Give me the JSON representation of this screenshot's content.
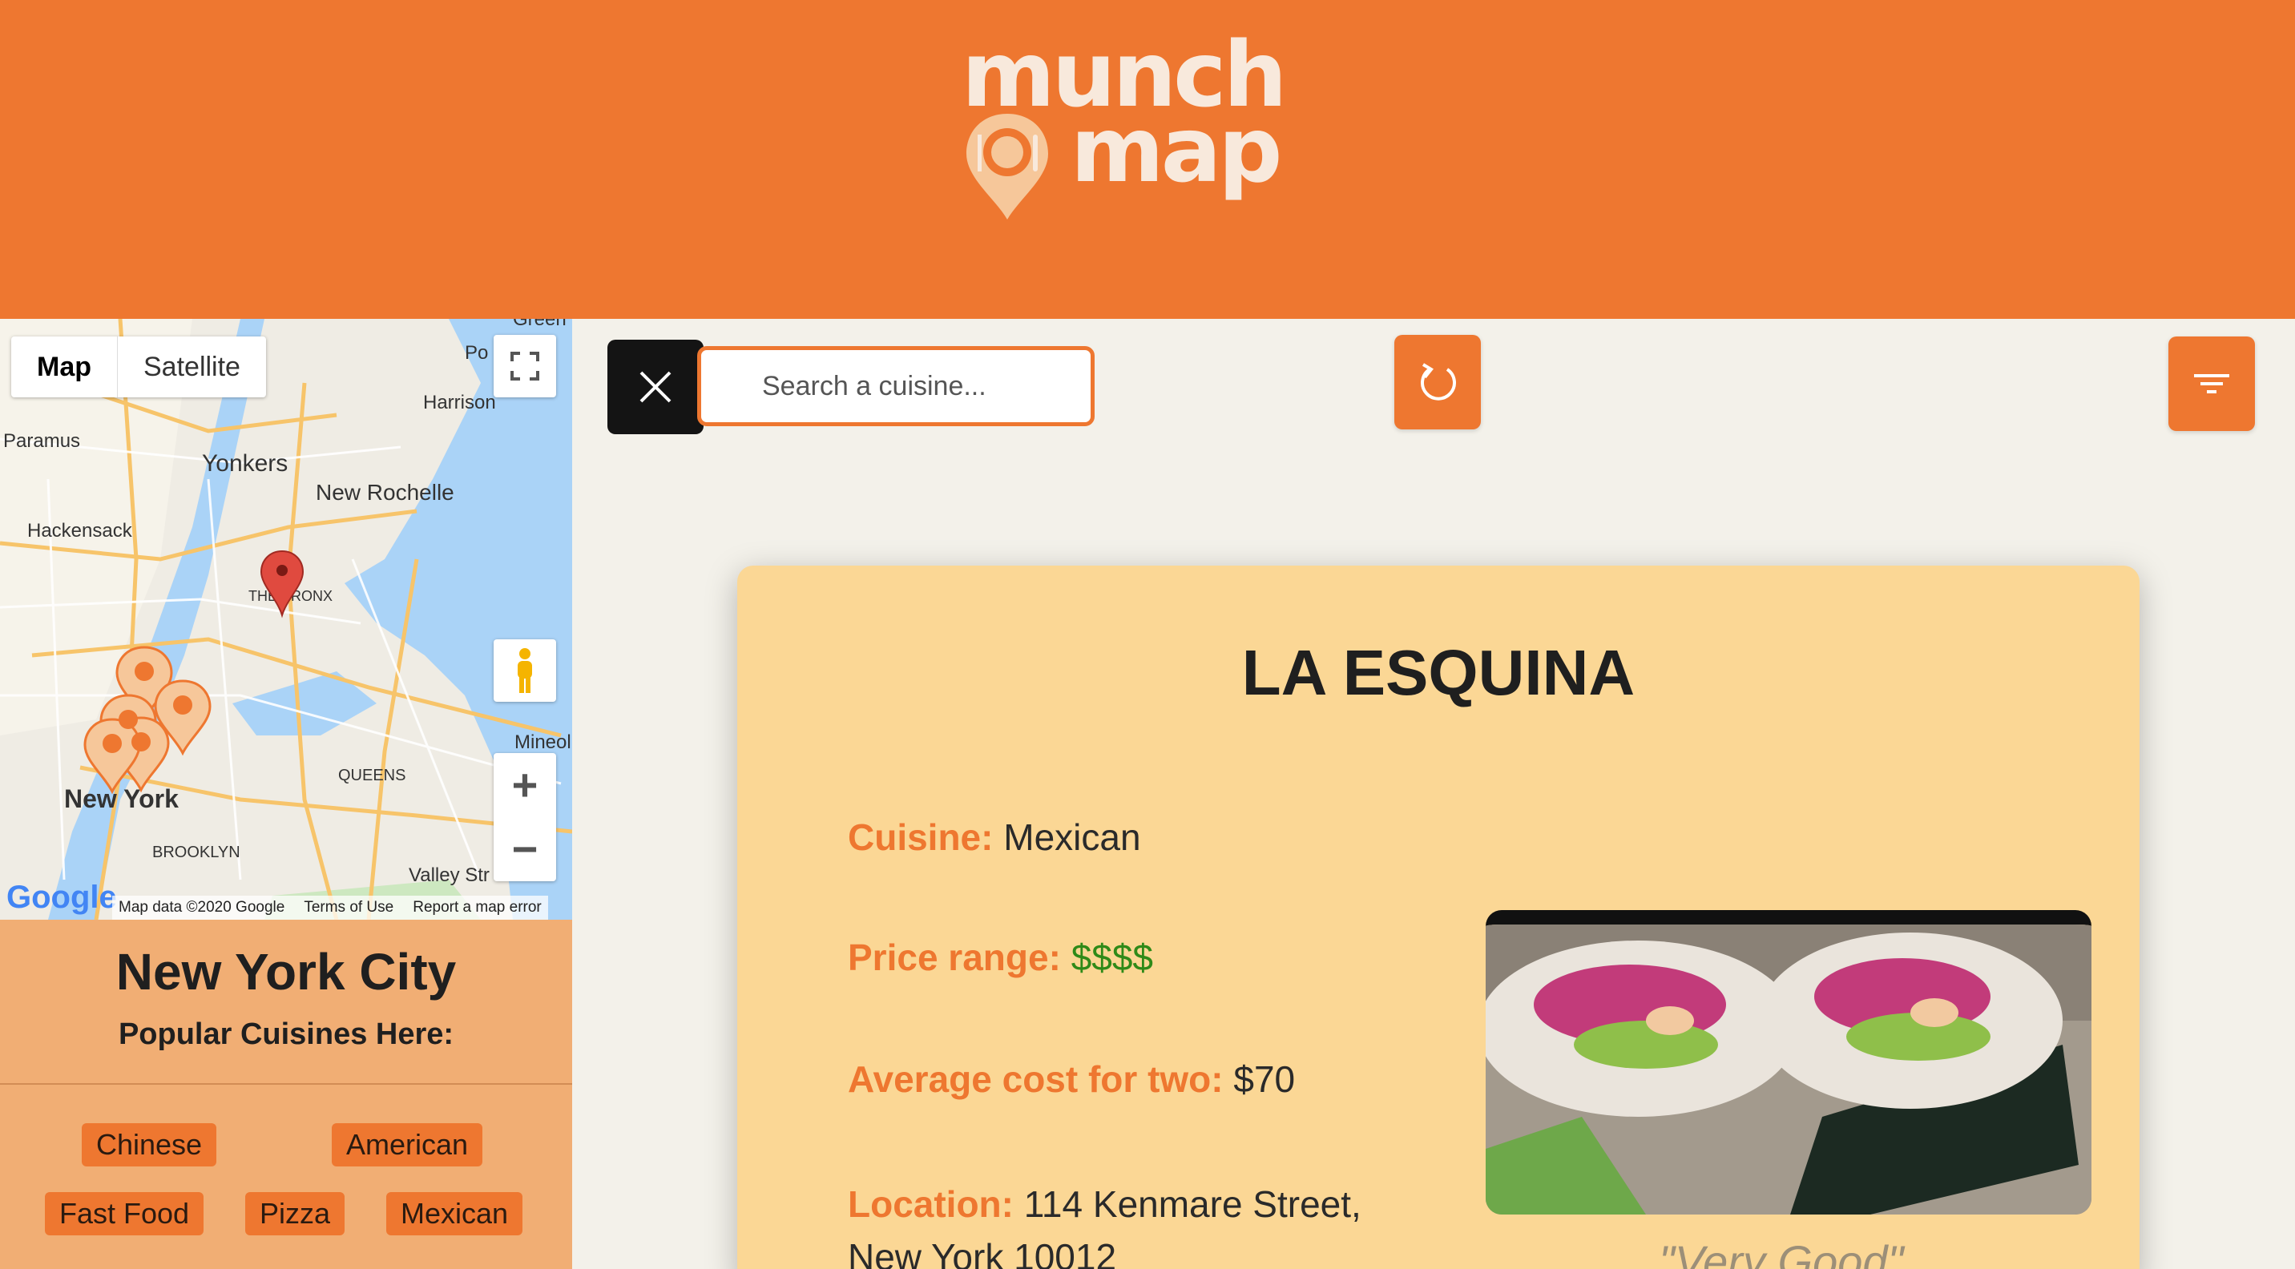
{
  "brand": {
    "word1": "munch",
    "word2": "map"
  },
  "map": {
    "type_buttons": [
      "Map",
      "Satellite"
    ],
    "labels": {
      "yonkers": "Yonkers",
      "new_rochelle": "New Rochelle",
      "paramus": "Paramus",
      "hackensack": "Hackensack",
      "harrison": "Harrison",
      "the_bronx": "THE BRONX",
      "new_york": "New York",
      "queens": "QUEENS",
      "brooklyn": "BROOKLYN",
      "mineola": "Mineol",
      "valley_stream": "Valley Str",
      "green": "Green",
      "port": "Po"
    },
    "footer": {
      "data": "Map data ©2020 Google",
      "terms": "Terms of Use",
      "report": "Report a map error"
    },
    "google": "Google",
    "zoom_in": "+",
    "zoom_out": "−"
  },
  "city": {
    "name": "New York City",
    "popular_label": "Popular Cuisines Here:",
    "cuisines": [
      "Chinese",
      "American",
      "Fast Food",
      "Pizza",
      "Mexican"
    ]
  },
  "search": {
    "placeholder": "Search a cuisine..."
  },
  "restaurant": {
    "name": "LA ESQUINA",
    "cuisine_label": "Cuisine:",
    "cuisine": "Mexican",
    "price_label": "Price range:",
    "price": "$$$$",
    "cost_label": "Average cost for two:",
    "cost": "$70",
    "location_label": "Location:",
    "location_line1": "114 Kenmare Street,",
    "location_line2": "New York 10012",
    "review": "\"Very Good\""
  },
  "colors": {
    "accent": "#ee7730",
    "card": "#fbd795",
    "sidebar": "#f1ae74",
    "price": "#2f8a18"
  },
  "icons": {
    "close": "close-icon",
    "refresh": "refresh-icon",
    "filter": "filter-icon"
  }
}
